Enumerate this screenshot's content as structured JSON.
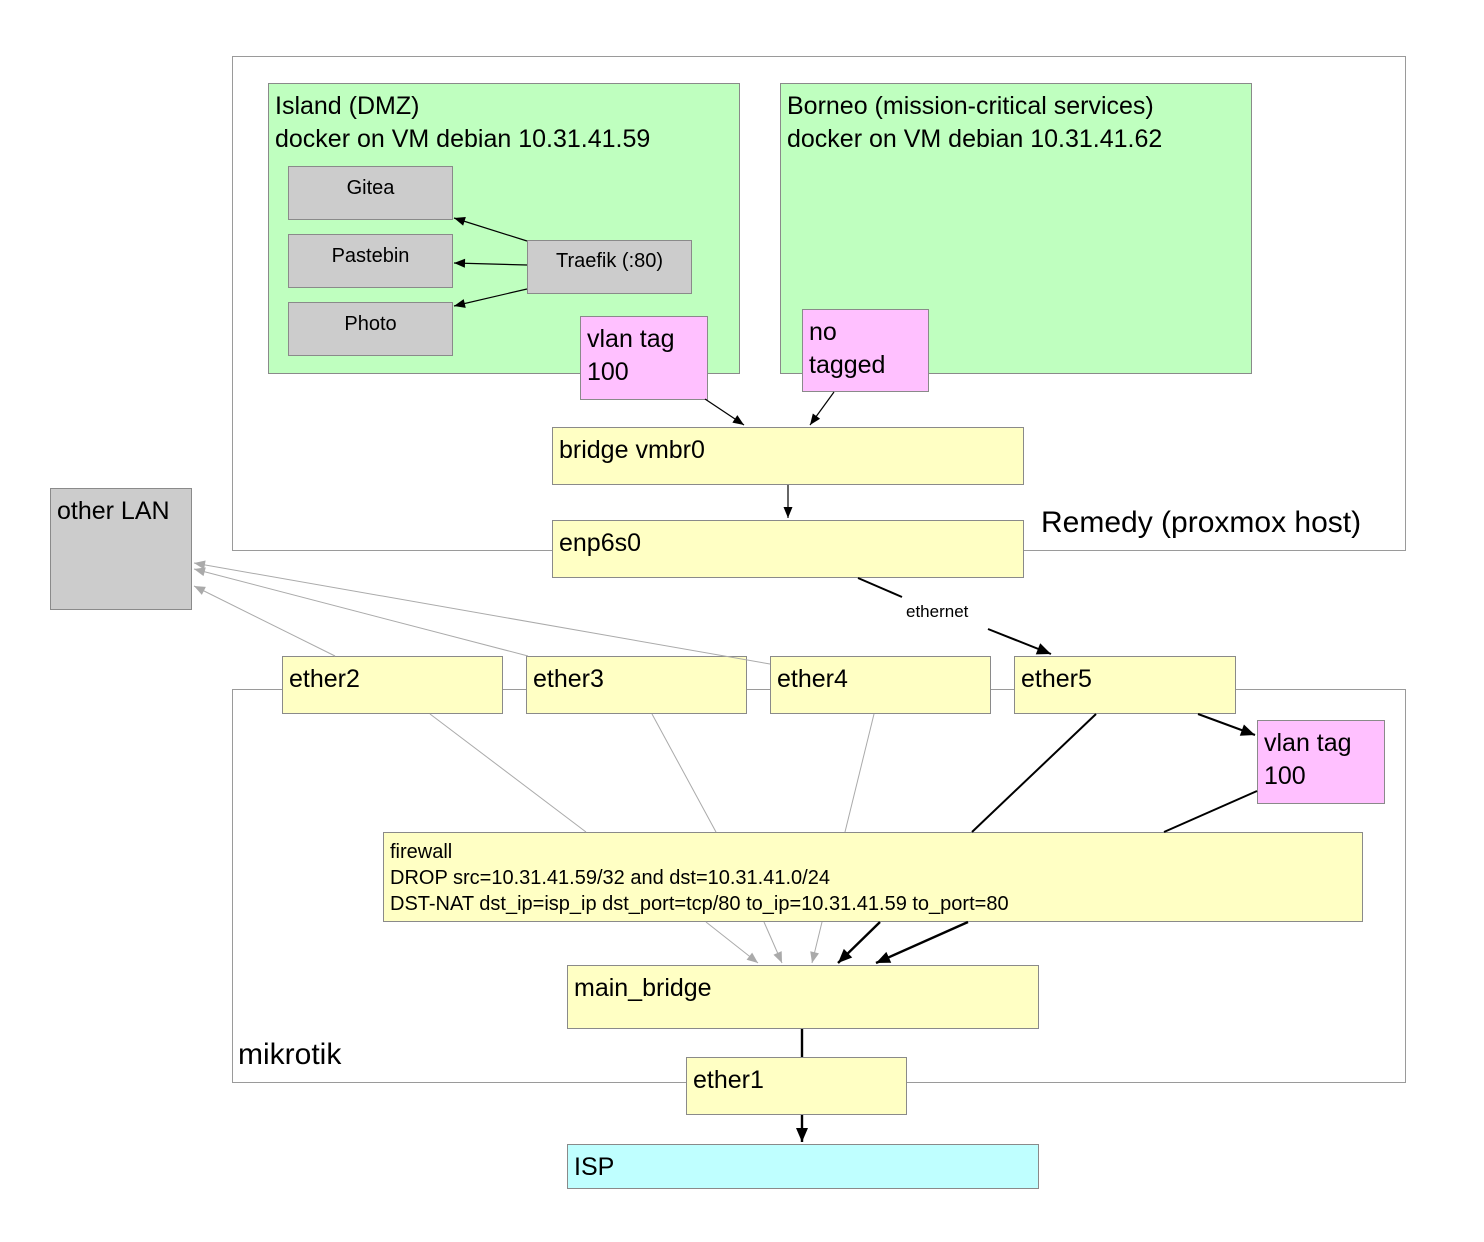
{
  "containers": {
    "remedy": "Remedy (proxmox host)",
    "mikrotik": "mikrotik"
  },
  "nodes": {
    "island": "Island (DMZ)\ndocker on VM debian 10.31.41.59",
    "borneo": "Borneo (mission-critical services)\ndocker on VM debian 10.31.41.62",
    "gitea": "Gitea",
    "pastebin": "Pastebin",
    "photo": "Photo",
    "traefik": "Traefik (:80)",
    "vlan_island": "vlan tag\n100",
    "no_tagged": "no\ntagged",
    "bridge": "bridge vmbr0",
    "enp6s0": "enp6s0",
    "other_lan": "other LAN",
    "ether2": "ether2",
    "ether3": "ether3",
    "ether4": "ether4",
    "ether5": "ether5",
    "vlan_mikrotik": "vlan tag\n100",
    "firewall": "firewall\nDROP src=10.31.41.59/32 and dst=10.31.41.0/24\nDST-NAT dst_ip=isp_ip dst_port=tcp/80 to_ip=10.31.41.59 to_port=80",
    "main_bridge": "main_bridge",
    "ether1": "ether1",
    "isp": "ISP"
  },
  "edges": {
    "ethernet_label": "ethernet"
  },
  "colors": {
    "vm": "#bfffbf",
    "service": "#cccccc",
    "vlan": "#ffc0ff",
    "interface": "#ffffc4",
    "isp": "#bfffff",
    "secondary_edge": "#aaaaaa",
    "primary_edge": "#000000"
  }
}
